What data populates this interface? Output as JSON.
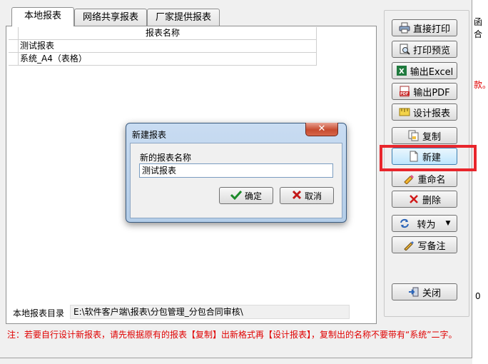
{
  "background": {
    "right_text_1": "函合",
    "right_text_2": "款。",
    "right_digit": "0"
  },
  "tabs": [
    {
      "label": "本地报表",
      "active": true
    },
    {
      "label": "网络共享报表",
      "active": false
    },
    {
      "label": "厂家提供报表",
      "active": false
    }
  ],
  "grid": {
    "header": "报表名称",
    "rows": [
      "测试报表",
      "系统_A4（表格）"
    ]
  },
  "directory": {
    "label": "本地报表目录",
    "value": "E:\\软件客户端\\报表\\分包管理_分包合同审核\\"
  },
  "buttons": {
    "direct_print": "直接打印",
    "print_preview": "打印预览",
    "export_excel": "输出Excel",
    "export_pdf": "输出PDF",
    "design_report": "设计报表",
    "copy": "复制",
    "new": "新建",
    "rename": "重命名",
    "delete": "删除",
    "convert": "转为",
    "write_note": "写备注",
    "close": "关闭"
  },
  "note": "注：若要自行设计新报表，请先根据原有的报表【复制】出新格式再【设计报表】，复制出的名称不要带有“系统”二字。",
  "dialog": {
    "title": "新建报表",
    "field_label": "新的报表名称",
    "field_value": "测试报表",
    "ok": "确定",
    "cancel": "取消"
  },
  "colors": {
    "highlight": "#e8262c",
    "note_text": "#e00000",
    "dialog_frame": "#b3cde8"
  }
}
